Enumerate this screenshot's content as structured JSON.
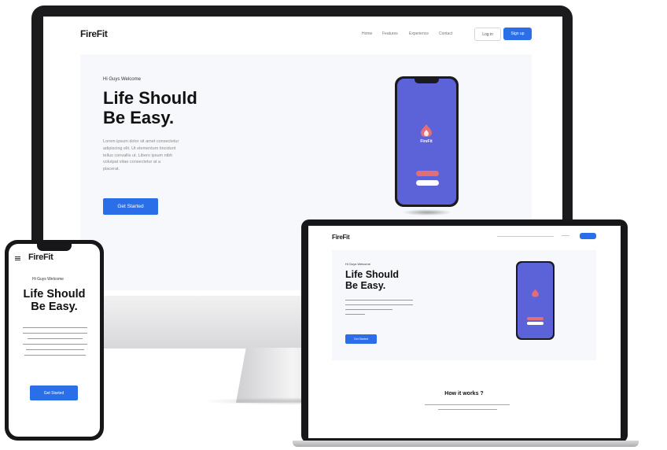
{
  "desktop": {
    "logo": "FireFit",
    "nav": [
      "Home",
      "Features",
      "Experience",
      "Contact"
    ],
    "login_label": "Log in",
    "signup_label": "Sign up",
    "eyebrow": "Hi Guys Welcome",
    "headline_line1": "Life Should",
    "headline_line2": "Be Easy.",
    "body_lines": [
      "Lorem ipsum dolor sit amet consectetur",
      "adipiscing elit. Ut elementum tincidunt",
      "tellus convallis ut. Libero ipsum nibh",
      "volutpat vitae consectetur at a",
      "placerat."
    ],
    "cta_label": "Get Started",
    "app_name": "FireFit"
  },
  "laptop": {
    "logo": "FireFit",
    "eyebrow": "Hi Guys Welcome",
    "headline_line1": "Life Should",
    "headline_line2": "Be Easy.",
    "cta_label": "Get Started",
    "section_title": "How it works ?"
  },
  "phone": {
    "logo": "FireFit",
    "eyebrow": "Hi Guys Welcome",
    "headline_line1": "Life Should",
    "headline_line2": "Be Easy.",
    "cta_label": "Get Started"
  },
  "colors": {
    "brand_blue": "#2a6fe8",
    "app_purple": "#5c63d9",
    "accent_red": "#e26f77"
  }
}
